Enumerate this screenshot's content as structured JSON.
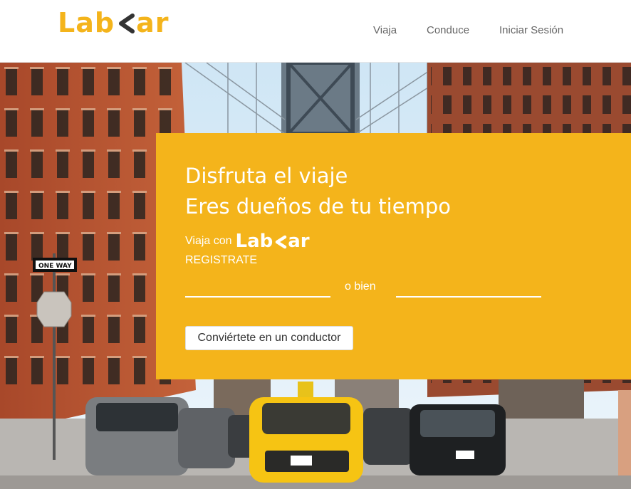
{
  "brand": {
    "name_left": "Lab",
    "name_right": "ar",
    "accent": "#f4b41b",
    "dark": "#333333"
  },
  "nav": {
    "items": [
      "Viaja",
      "Conduce",
      "Iniciar Sesión"
    ]
  },
  "hero": {
    "headline_1": "Disfruta el viaje",
    "headline_2": "Eres dueños de tu tiempo",
    "ride_prefix": "Viaja con",
    "register": "REGISTRATE",
    "or_text": "o bien",
    "driver_button": "Conviértete en un conductor"
  },
  "street_sign": "ONE WAY"
}
